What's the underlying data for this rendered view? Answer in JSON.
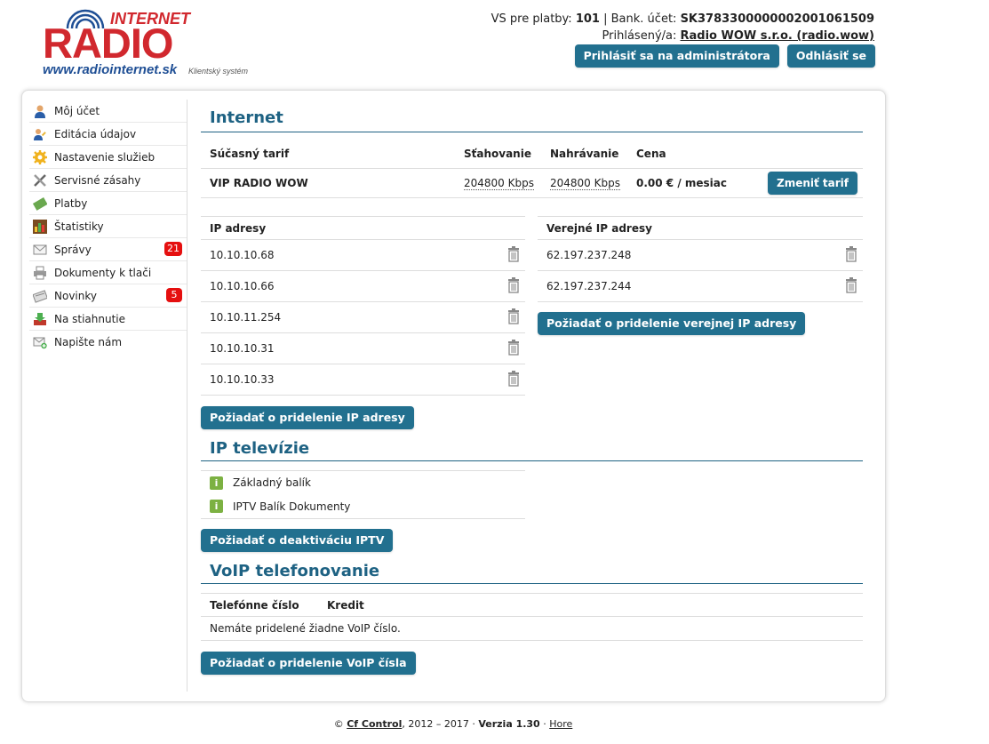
{
  "logo": {
    "internet": "INTERNET",
    "brand": "RADIO",
    "url": "www.radiointernet.sk",
    "subtitle": "Klientský systém"
  },
  "header": {
    "vs_label": "VS pre platby:",
    "vs_value": "101",
    "bank_label": "Bank. účet:",
    "bank_value": "SK3783300000002001061509",
    "logged_label": "Prihlásený/a:",
    "logged_user": "Radio WOW s.r.o. (radio.wow)",
    "admin_button": "Prihlásiť sa na administrátora",
    "logout_button": "Odhlásiť se"
  },
  "sidebar": {
    "items": [
      {
        "label": "Môj účet",
        "icon": "user-icon"
      },
      {
        "label": "Editácia údajov",
        "icon": "users-edit-icon"
      },
      {
        "label": "Nastavenie služieb",
        "icon": "gear-icon"
      },
      {
        "label": "Servisné zásahy",
        "icon": "tools-icon"
      },
      {
        "label": "Platby",
        "icon": "money-icon"
      },
      {
        "label": "Štatistiky",
        "icon": "chart-icon"
      },
      {
        "label": "Správy",
        "icon": "envelope-icon",
        "badge": "21"
      },
      {
        "label": "Dokumenty k tlači",
        "icon": "printer-icon"
      },
      {
        "label": "Novinky",
        "icon": "newspaper-icon",
        "badge": "5"
      },
      {
        "label": "Na stiahnutie",
        "icon": "download-icon"
      },
      {
        "label": "Napište nám",
        "icon": "envelope-add-icon"
      }
    ]
  },
  "internet": {
    "title": "Internet",
    "headers": {
      "tariff": "Súčasný tarif",
      "download": "Sťahovanie",
      "upload": "Nahrávanie",
      "price": "Cena"
    },
    "tariff_name": "VIP RADIO WOW",
    "download": "204800 Kbps",
    "upload": "204800 Kbps",
    "price": "0.00 € / mesiac",
    "change_button": "Zmeniť tarif",
    "ip_header": "IP adresy",
    "ips": [
      "10.10.10.68",
      "10.10.10.66",
      "10.10.11.254",
      "10.10.10.31",
      "10.10.10.33"
    ],
    "ip_button": "Požiadať o pridelenie IP adresy",
    "public_header": "Verejné IP adresy",
    "public_ips": [
      "62.197.237.248",
      "62.197.237.244"
    ],
    "public_button": "Požiadať o pridelenie verejnej IP adresy"
  },
  "iptv": {
    "title": "IP televízie",
    "packages": [
      "Základný balík",
      "IPTV Balík Dokumenty"
    ],
    "button": "Požiadať o deaktiváciu IPTV"
  },
  "voip": {
    "title": "VoIP telefonovanie",
    "headers": {
      "number": "Telefónne číslo",
      "credit": "Kredit"
    },
    "empty_text": "Nemáte pridelené žiadne VoIP číslo.",
    "button": "Požiadať o pridelenie VoIP čísla"
  },
  "footer": {
    "copyright": "©",
    "company": "Cf Control",
    "years": ", 2012 – 2017 ·",
    "version": "Verzia 1.30",
    "sep": "·",
    "top_link": "Hore"
  },
  "colors": {
    "accent": "#22708f",
    "heading": "#1e6283",
    "logo_red": "#d1282e",
    "badge": "#e50f0f"
  }
}
